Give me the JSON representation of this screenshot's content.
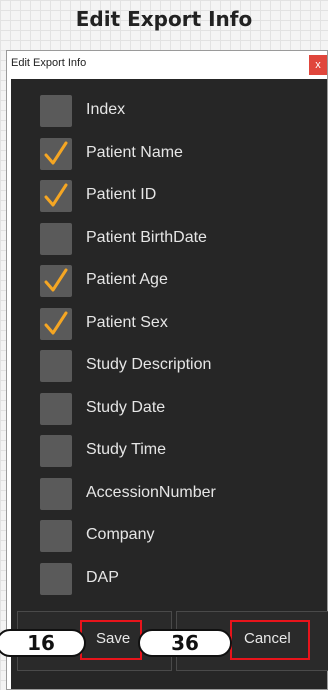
{
  "caption": "Edit Export Info",
  "window": {
    "title": "Edit Export Info",
    "close_glyph": "x"
  },
  "checkboxes": [
    {
      "label": "Index",
      "checked": false
    },
    {
      "label": "Patient Name",
      "checked": true
    },
    {
      "label": "Patient ID",
      "checked": true
    },
    {
      "label": "Patient BirthDate",
      "checked": false
    },
    {
      "label": "Patient Age",
      "checked": true
    },
    {
      "label": "Patient Sex",
      "checked": true
    },
    {
      "label": "Study Description",
      "checked": false
    },
    {
      "label": "Study Date",
      "checked": false
    },
    {
      "label": "Study Time",
      "checked": false
    },
    {
      "label": "AccessionNumber",
      "checked": false
    },
    {
      "label": "Company",
      "checked": false
    },
    {
      "label": "DAP",
      "checked": false
    }
  ],
  "buttons": {
    "save_label": "Save",
    "cancel_label": "Cancel"
  },
  "annotations": {
    "save_badge": "16",
    "cancel_badge": "36"
  },
  "colors": {
    "check_accent": "#f5a623",
    "highlight_box": "#e8141b",
    "close_button": "#e0463c"
  },
  "icons": {
    "close": "close-icon",
    "check": "checkmark-icon"
  }
}
